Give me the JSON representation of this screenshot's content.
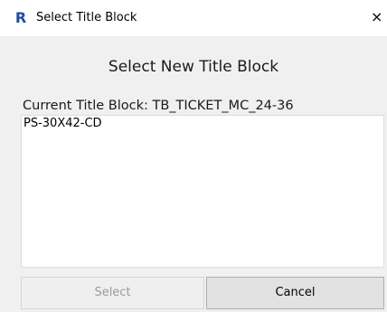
{
  "window": {
    "app_icon_letter": "R",
    "title": "Select Title Block",
    "close_glyph": "×"
  },
  "dialog": {
    "heading": "Select New Title Block",
    "current_title_block_label": "Current Title Block: TB_TICKET_MC_24-36",
    "list_items": [
      "PS-30X42-CD"
    ],
    "buttons": {
      "select_label": "Select",
      "cancel_label": "Cancel",
      "select_enabled": false
    }
  },
  "colors": {
    "app_icon": "#1f4e9c",
    "dialog_background": "#f0f0f0",
    "list_background": "#ffffff",
    "disabled_text": "#9a9a9a"
  }
}
